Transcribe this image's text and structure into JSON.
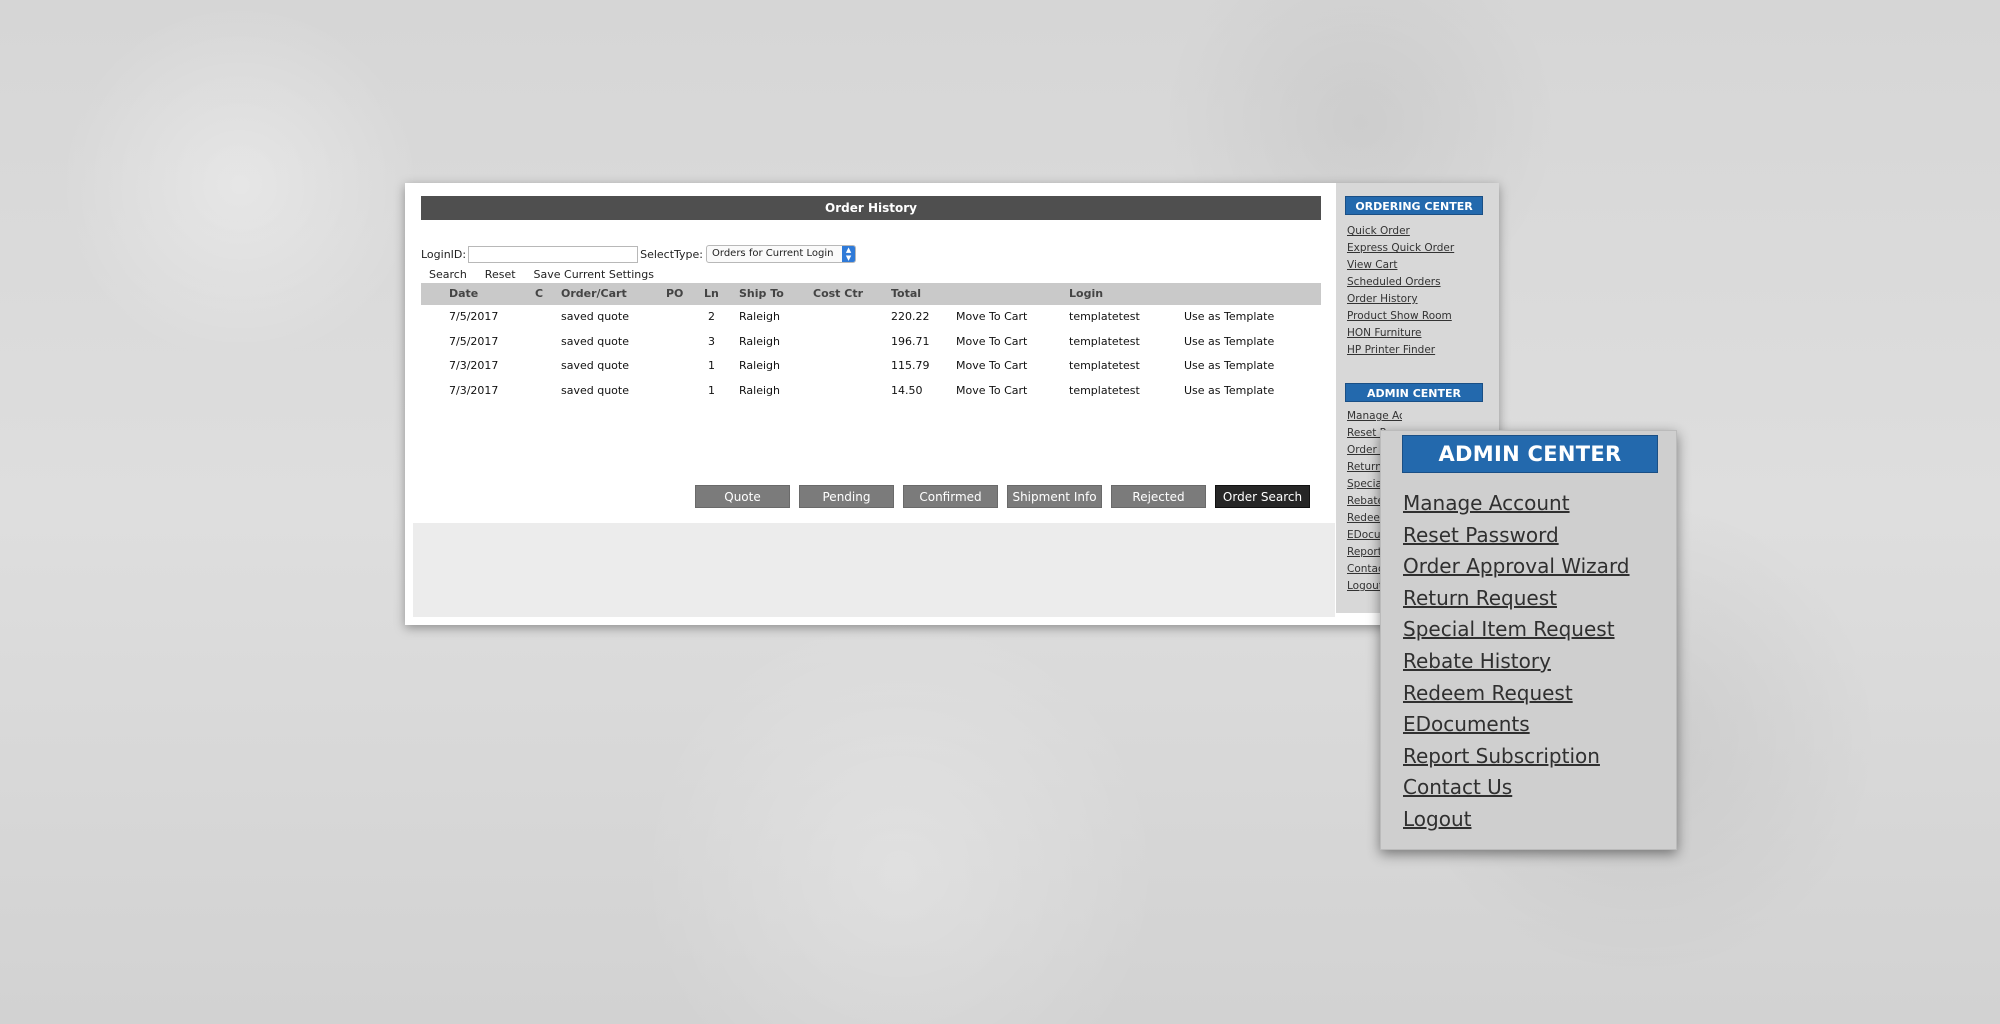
{
  "order_history": {
    "title": "Order History",
    "filters": {
      "login_id_label": "LoginID:",
      "login_id_value": "",
      "select_type_label": "SelectType:",
      "select_type_value": "Orders for Current Login"
    },
    "actions": {
      "search": "Search",
      "reset": "Reset",
      "save_settings": "Save Current Settings"
    },
    "columns": {
      "date": "Date",
      "c": "C",
      "order_cart": "Order/Cart",
      "po": "PO",
      "ln": "Ln",
      "ship_to": "Ship To",
      "cost_ctr": "Cost Ctr",
      "total": "Total",
      "login": "Login"
    },
    "rows": [
      {
        "date": "7/5/2017",
        "order": "saved quote",
        "ln": "2",
        "ship_to": "Raleigh",
        "total": "220.22",
        "move": "Move To Cart",
        "login": "templatetest",
        "template": "Use as Template"
      },
      {
        "date": "7/5/2017",
        "order": "saved quote",
        "ln": "3",
        "ship_to": "Raleigh",
        "total": "196.71",
        "move": "Move To Cart",
        "login": "templatetest",
        "template": "Use as Template"
      },
      {
        "date": "7/3/2017",
        "order": "saved quote",
        "ln": "1",
        "ship_to": "Raleigh",
        "total": "115.79",
        "move": "Move To Cart",
        "login": "templatetest",
        "template": "Use as Template"
      },
      {
        "date": "7/3/2017",
        "order": "saved quote",
        "ln": "1",
        "ship_to": "Raleigh",
        "total": "14.50",
        "move": "Move To Cart",
        "login": "templatetest",
        "template": "Use as Template"
      }
    ],
    "status_buttons": {
      "quote": "Quote",
      "pending": "Pending",
      "confirmed": "Confirmed",
      "shipment_info": "Shipment Info",
      "rejected": "Rejected",
      "order_search": "Order Search"
    }
  },
  "sidebar": {
    "ordering_center": {
      "title": "ORDERING CENTER",
      "items": [
        "Quick Order",
        "Express Quick Order",
        "View Cart",
        "Scheduled Orders",
        "Order History",
        "Product Show Room",
        "HON Furniture",
        "HP Printer Finder"
      ]
    },
    "admin_center": {
      "title": "ADMIN CENTER",
      "items": [
        "Manage Account",
        "Reset P",
        "Order A",
        "Return",
        "Special",
        "Rebate",
        "Redeem",
        "EDocum",
        "Report",
        "Contact",
        "Logout"
      ]
    }
  },
  "admin_popup": {
    "title": "ADMIN CENTER",
    "items": [
      "Manage Account",
      "Reset Password",
      "Order Approval Wizard",
      "Return Request",
      "Special Item Request",
      "Rebate History",
      "Redeem Request",
      "EDocuments",
      "Report Subscription",
      "Contact Us",
      "Logout"
    ]
  },
  "colors": {
    "accent_blue": "#2369ad",
    "title_bar": "#4f4f4f",
    "status_button": "#7b7b7b",
    "order_search_button": "#262626"
  }
}
